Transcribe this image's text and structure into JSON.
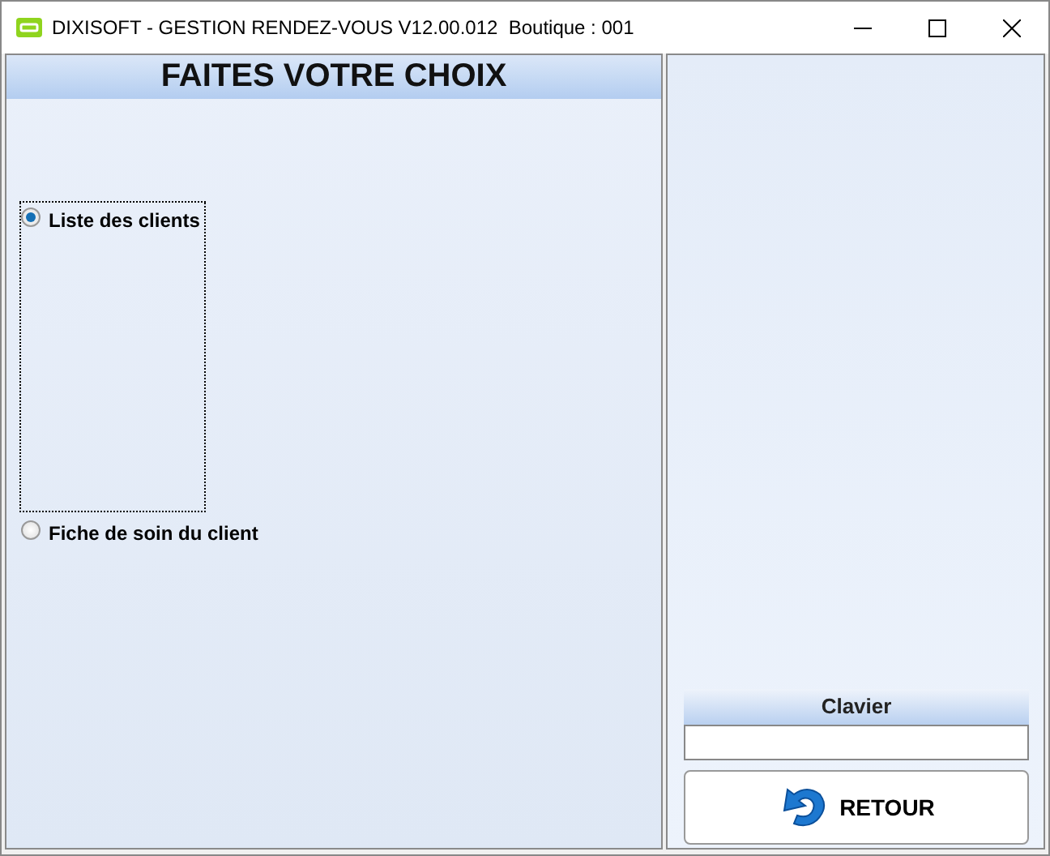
{
  "window": {
    "title": "DIXISOFT - GESTION RENDEZ-VOUS V12.00.012  Boutique : 001"
  },
  "panel": {
    "title": "FAITES VOTRE CHOIX"
  },
  "options": [
    {
      "label": "Liste des clients",
      "selected": true
    },
    {
      "label": "Fiche de soin du client",
      "selected": false
    }
  ],
  "keyboard": {
    "label": "Clavier"
  },
  "buttons": [
    {
      "label": "RETOUR"
    }
  ]
}
